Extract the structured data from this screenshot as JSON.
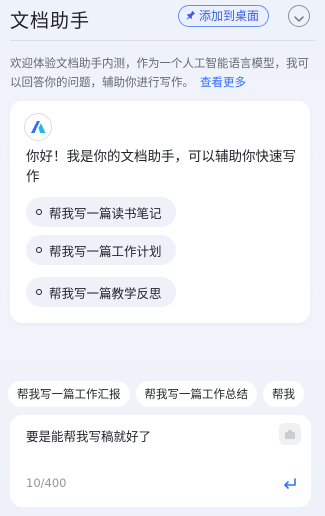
{
  "header": {
    "title": "文档助手",
    "pin_label": "添加到桌面"
  },
  "intro": {
    "text": "欢迎体验文档助手内测，作为一个人工智能语言模型，我可以回答你的问题，辅助你进行写作。",
    "more_link": "查看更多"
  },
  "card": {
    "greeting": "你好！我是你的文档助手，可以辅助你快速写作",
    "suggestions": [
      {
        "label": "帮我写一篇读书笔记"
      },
      {
        "label": "帮我写一篇工作计划"
      },
      {
        "label": "帮我写一篇教学反思"
      }
    ]
  },
  "chips": [
    {
      "label": "帮我写一篇工作汇报"
    },
    {
      "label": "帮我写一篇工作总结"
    },
    {
      "label": "帮我"
    }
  ],
  "input": {
    "value": "要是能帮我写稿就好了",
    "counter": "10/400"
  },
  "colors": {
    "accent": "#3370ff",
    "pin_border": "#6b8cf5",
    "pin_bg": "#eaf0ff",
    "page_bg": "#eef2fb"
  },
  "icons": {
    "pin": "pin-icon",
    "collapse": "chevron-down-icon",
    "logo": "assistant-logo-icon",
    "clear": "clear-icon",
    "send": "enter-return-icon"
  }
}
